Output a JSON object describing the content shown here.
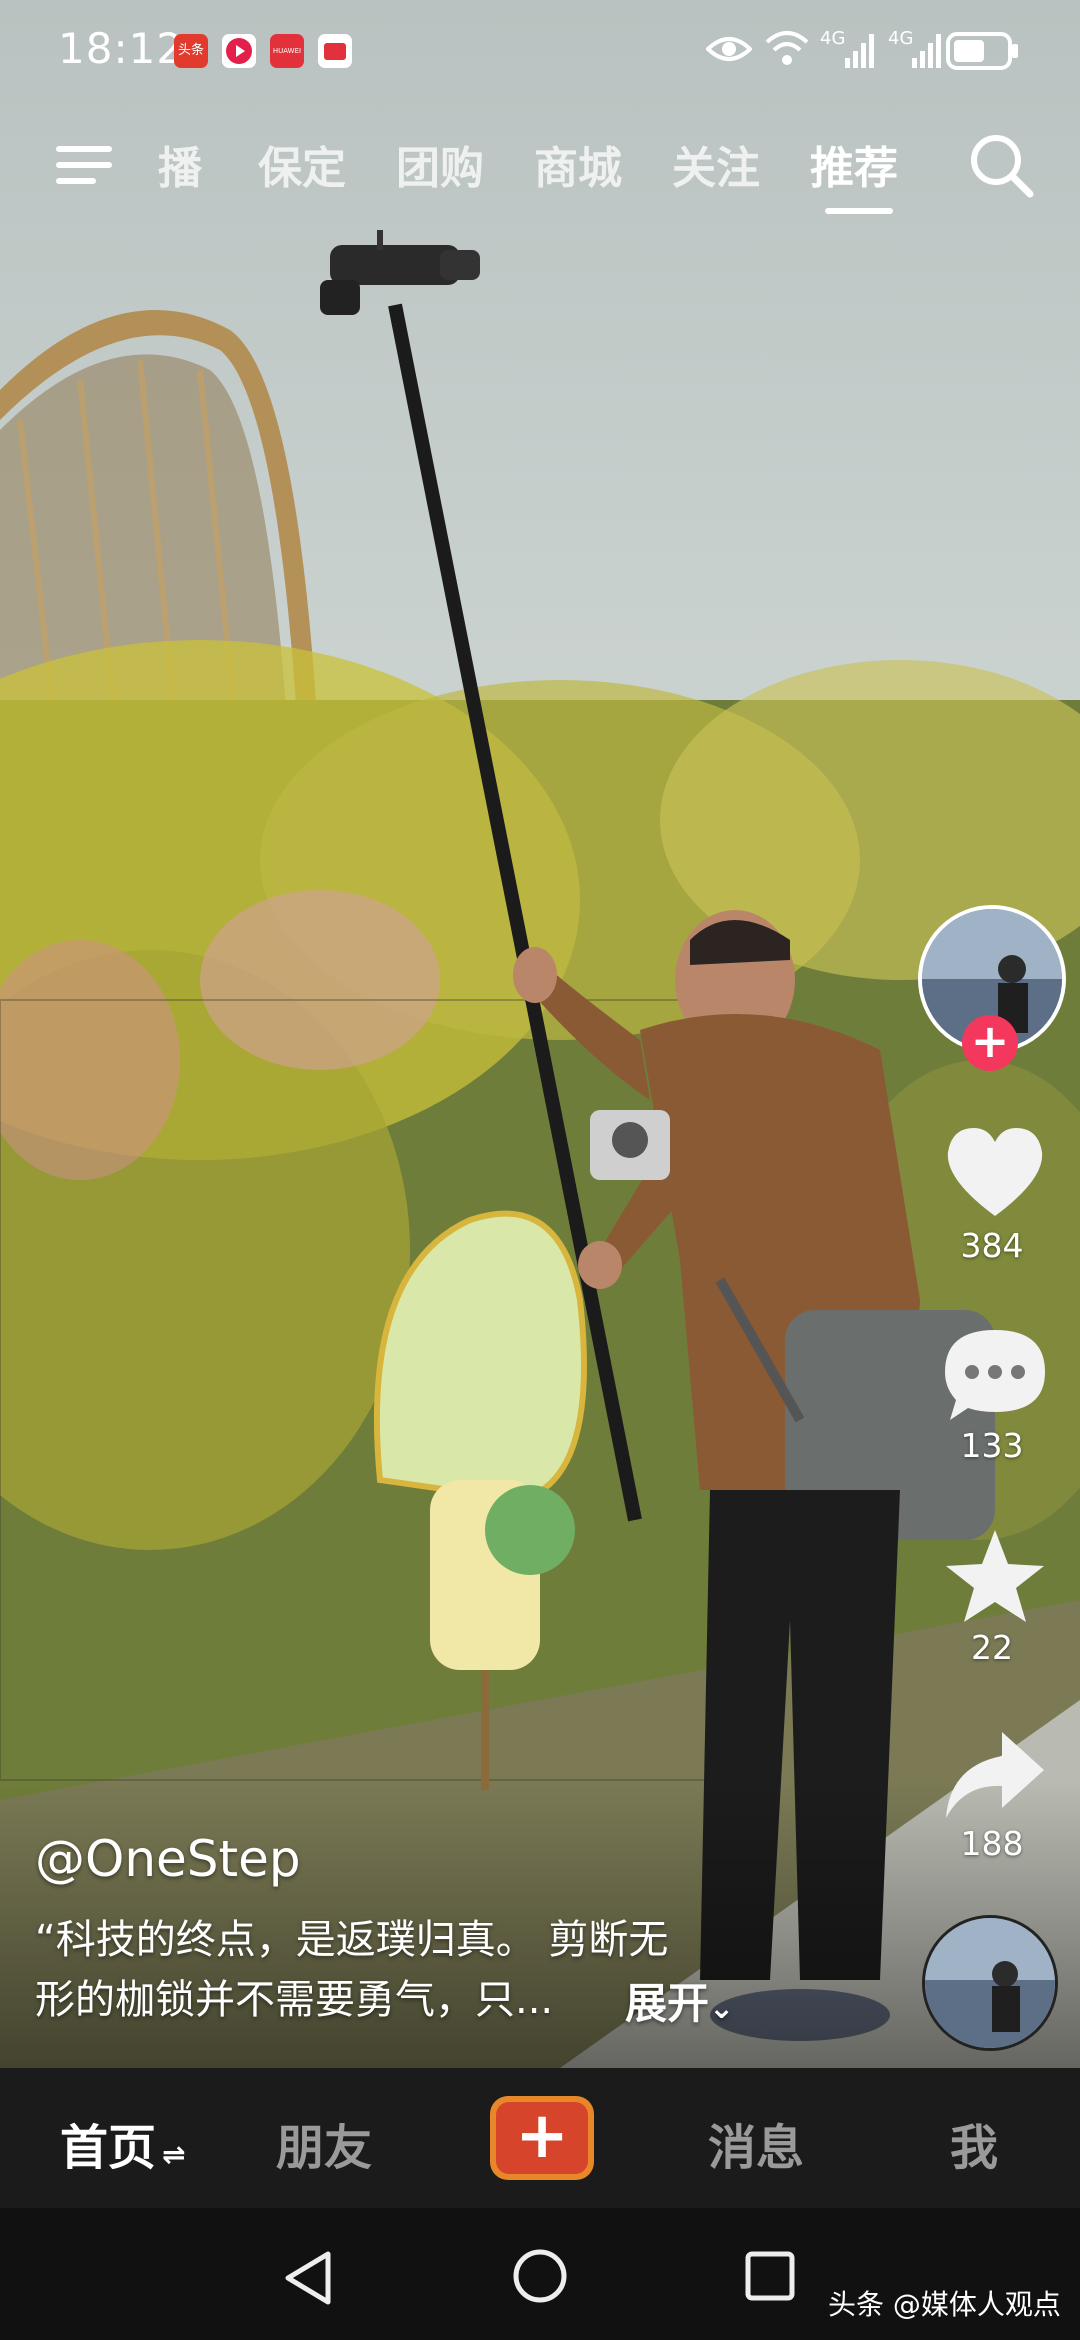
{
  "status_bar": {
    "time": "18:12",
    "app_badge_1": "头条",
    "app_badge_2": "HUAWEI",
    "signal_1": "4G",
    "signal_2": "4G"
  },
  "top_nav": {
    "tabs": [
      "播",
      "保定",
      "团购",
      "商城",
      "关注",
      "推荐"
    ],
    "active_tab": "推荐"
  },
  "actions": {
    "likes": "384",
    "comments": "133",
    "favorites": "22",
    "shares": "188"
  },
  "post": {
    "username": "@OneStep",
    "caption_line1": "“科技的终点，是返璞归真。 剪断无",
    "caption_line2": "形的枷锁并不需要勇气，只...",
    "expand_label": "展开"
  },
  "bottom_tabs": {
    "home": "首页",
    "friends": "朋友",
    "create": "+",
    "messages": "消息",
    "me": "我"
  },
  "watermark": "头条 @媒体人观点",
  "colors": {
    "follow_red": "#f4375c",
    "create_orange": "#e8862a",
    "create_red": "#d6452b",
    "tabbar_bg": "#1b1b1b"
  }
}
